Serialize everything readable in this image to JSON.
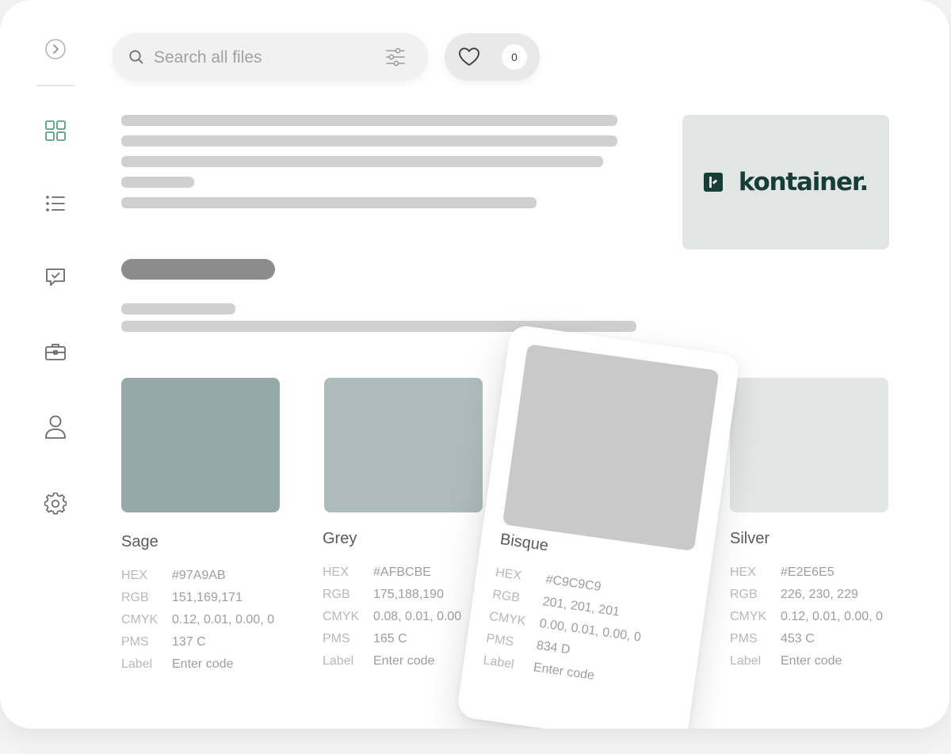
{
  "search": {
    "placeholder": "Search all files"
  },
  "favorites": {
    "count": "0"
  },
  "sidebar": {
    "icons": [
      "chevron-right-icon",
      "grid-icon",
      "list-icon",
      "comment-check-icon",
      "briefcase-icon",
      "user-icon",
      "gear-icon"
    ]
  },
  "brand": {
    "logo_text": "kontainer."
  },
  "field_labels": {
    "hex": "HEX",
    "rgb": "RGB",
    "cmyk": "CMYK",
    "pms": "PMS",
    "label": "Label"
  },
  "colors": [
    {
      "name": "Sage",
      "hex": "#97A9AB",
      "rgb": "151,169,171",
      "cmyk": "0.12, 0.01, 0.00, 0",
      "pms": "137 C",
      "label": "Enter code",
      "swatch": "#97a8aa"
    },
    {
      "name": "Grey",
      "hex": "#AFBCBE",
      "rgb": "175,188,190",
      "cmyk": "0.08, 0.01, 0.00",
      "pms": "165 C",
      "label": "Enter code",
      "swatch": "#adbbbc"
    },
    {
      "name": "Bisque",
      "hex": "#C9C9C9",
      "rgb": "201, 201, 201",
      "cmyk": "0.00, 0.01, 0.00, 0",
      "pms": "834 D",
      "label": "Enter code",
      "swatch": "#c9c9c9"
    },
    {
      "name": "Silver",
      "hex": "#E2E6E5",
      "rgb": "226, 230, 229",
      "cmyk": "0.12, 0.01, 0.00, 0",
      "pms": "453 C",
      "label": "Enter code",
      "swatch": "#e2e6e5"
    }
  ],
  "theme": {
    "skeleton": "#d0d0d0",
    "skeleton_dark": "#8c8c8c",
    "brand_dark": "#173e36"
  }
}
